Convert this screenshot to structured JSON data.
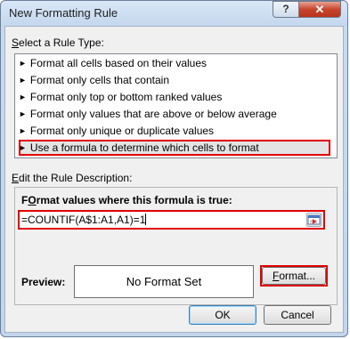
{
  "window": {
    "title": "New Formatting Rule",
    "help_label": "?",
    "close_label": "✕"
  },
  "rule_type_section": {
    "label_prefix": "S",
    "label_rest": "elect a Rule Type:",
    "bullet": "►",
    "items": [
      "Format all cells based on their values",
      "Format only cells that contain",
      "Format only top or bottom ranked values",
      "Format only values that are above or below average",
      "Format only unique or duplicate values",
      "Use a formula to determine which cells to format"
    ],
    "selected_index": 5
  },
  "description_section": {
    "label_prefix": "E",
    "label_rest": "dit the Rule Description:",
    "formula_label_prefix": "O",
    "formula_label_first": "F",
    "formula_label_rest": "rmat values where this formula is true:",
    "formula_value": "=COUNTIF(A$1:A1,A1)=1",
    "preview_label": "Preview:",
    "preview_text": "No Format Set",
    "format_button_prefix": "F",
    "format_button_rest": "ormat..."
  },
  "buttons": {
    "ok": "OK",
    "cancel": "Cancel"
  },
  "colors": {
    "highlight": "#e00000",
    "title_bar": "#c8daf0",
    "client_bg": "#f0f0f0"
  },
  "icons": {
    "collapse_dialog": "collapse-dialog-icon"
  }
}
